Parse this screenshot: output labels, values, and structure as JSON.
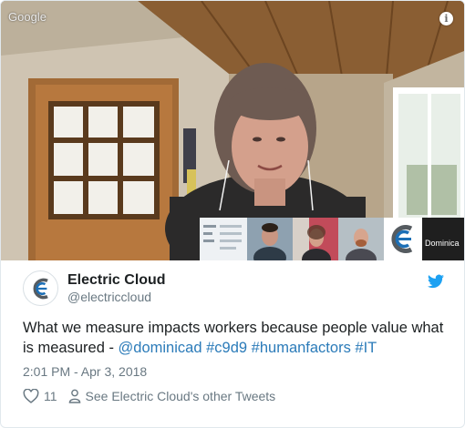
{
  "media": {
    "watermark": "Google",
    "info_icon": "info-icon",
    "participant_label": "Dominica"
  },
  "tweet": {
    "display_name": "Electric Cloud",
    "handle": "@electriccloud",
    "text_plain": "What we measure impacts workers because people value what is measured - ",
    "links": [
      "@dominicad",
      "#c9d9",
      "#humanfactors",
      "#IT"
    ],
    "timestamp": "2:01 PM - Apr 3, 2018",
    "like_count": "11",
    "profile_link": "See Electric Cloud's other Tweets"
  },
  "colors": {
    "link": "#2b7bb9",
    "text": "#1c2022",
    "muted": "#697882",
    "twitter_blue": "#1da1f2",
    "brand_blue": "#1c6fb6"
  },
  "icons": [
    "info-icon",
    "twitter-bird-icon",
    "heart-icon",
    "person-icon",
    "electric-cloud-logo-icon"
  ]
}
